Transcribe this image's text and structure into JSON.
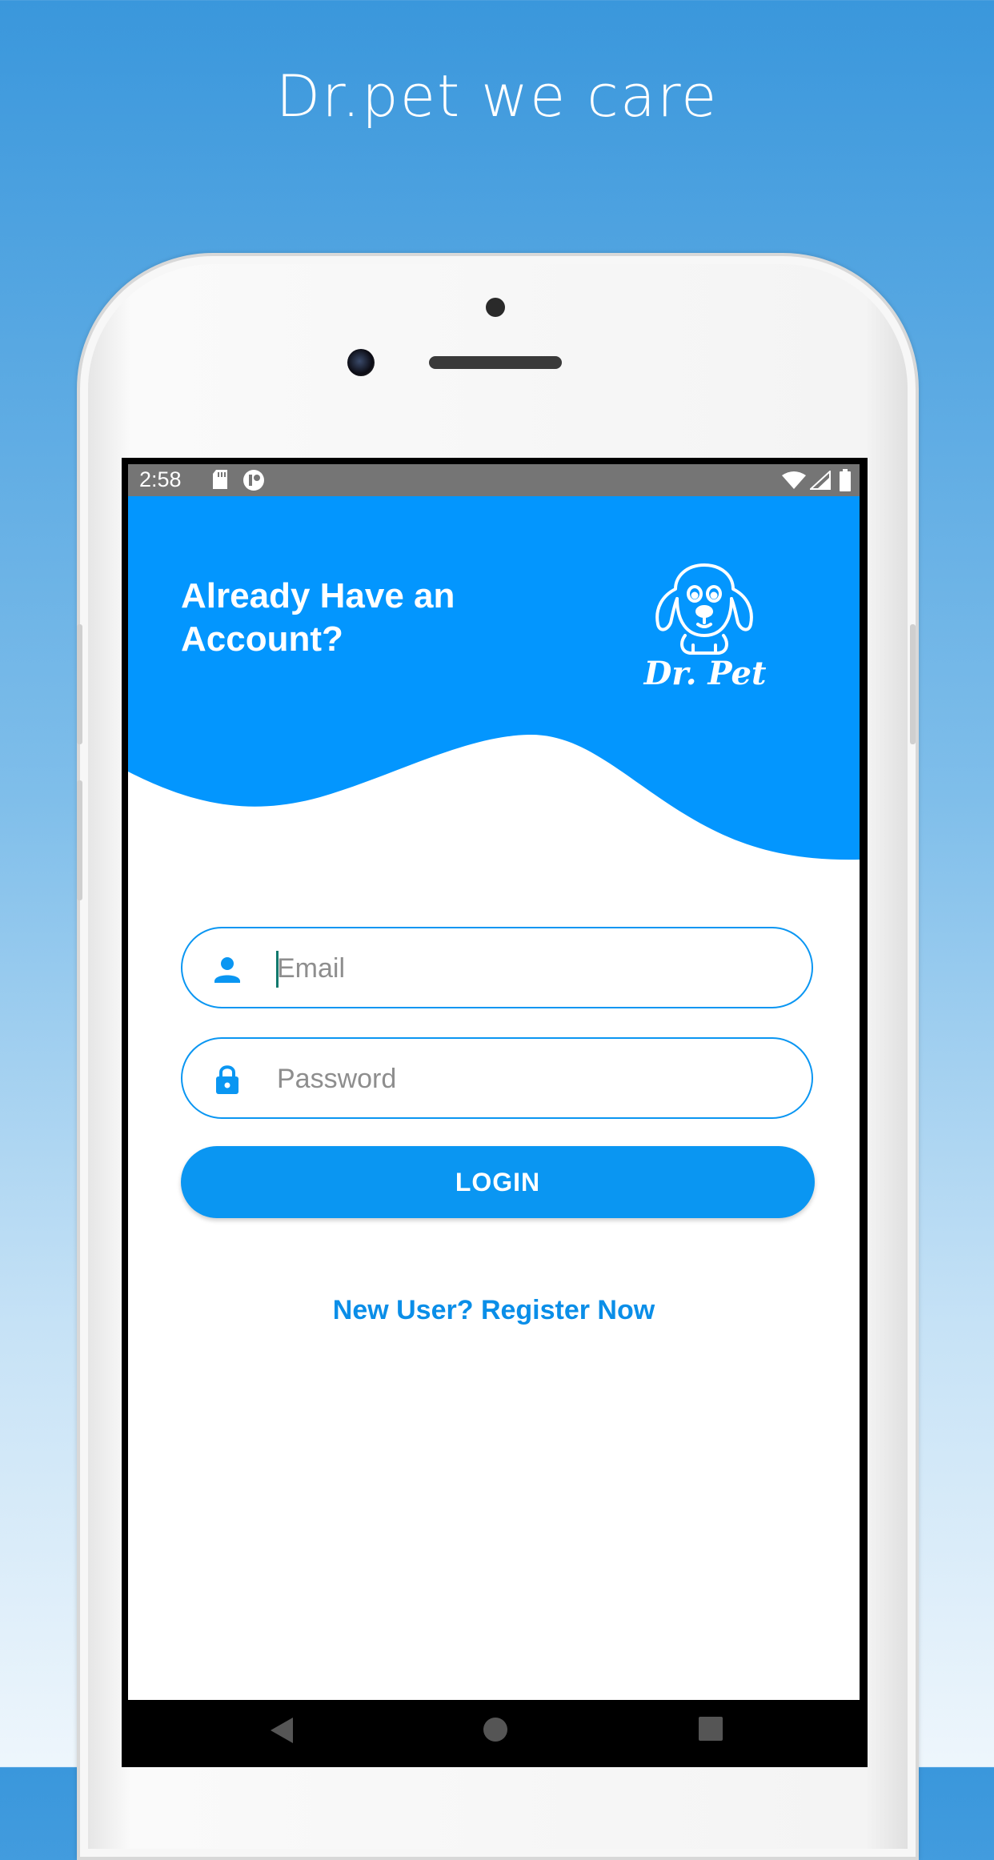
{
  "tagline": "Dr.pet we care",
  "status_bar": {
    "time": "2:58",
    "icons": [
      "sd-card-icon",
      "sync-icon",
      "wifi-icon",
      "signal-icon",
      "battery-icon"
    ]
  },
  "header": {
    "title": "Already Have an Account?",
    "logo_text": "Dr. Pet"
  },
  "form": {
    "email": {
      "placeholder": "Email",
      "value": "",
      "icon": "person-icon"
    },
    "password": {
      "placeholder": "Password",
      "value": "",
      "icon": "lock-icon"
    },
    "login_label": "LOGIN",
    "register_label": "New User? Register Now"
  },
  "nav": {
    "buttons": [
      "back-icon",
      "home-icon",
      "recents-icon"
    ]
  },
  "colors": {
    "accent": "#0a96f2",
    "status_bar": "#757575",
    "background_top": "#3a97dc"
  }
}
